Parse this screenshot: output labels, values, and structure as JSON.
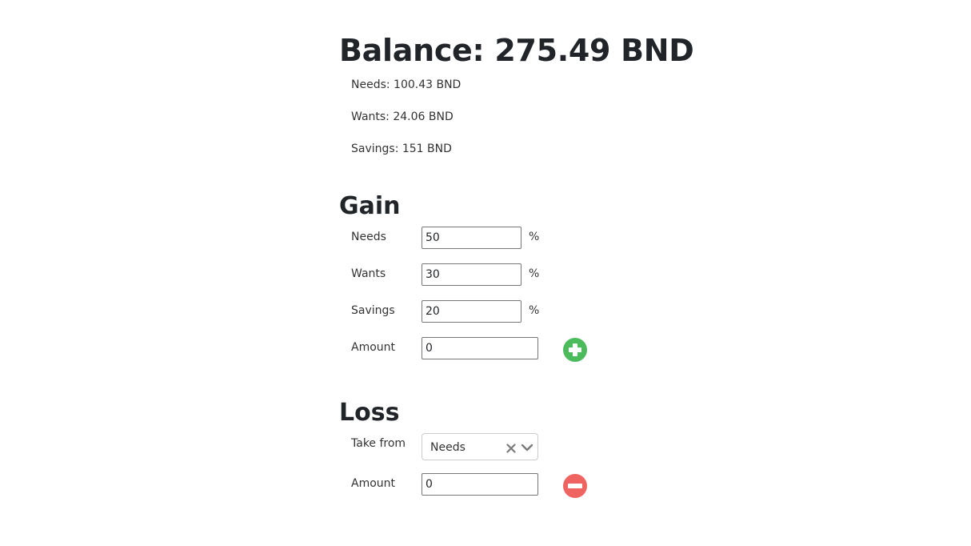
{
  "balance": {
    "title": "Balance: 275.49 BND",
    "needs": "Needs: 100.43 BND",
    "wants": "Wants: 24.06 BND",
    "savings": "Savings: 151 BND"
  },
  "gain": {
    "heading": "Gain",
    "needs_label": "Needs",
    "needs_value": "50",
    "wants_label": "Wants",
    "wants_value": "30",
    "savings_label": "Savings",
    "savings_value": "20",
    "percent_symbol": "%",
    "amount_label": "Amount",
    "amount_value": "0",
    "add_icon": "plus-circle-icon",
    "add_color": "#4cbb5c"
  },
  "loss": {
    "heading": "Loss",
    "take_from_label": "Take from",
    "take_from_value": "Needs",
    "clear_icon": "close-icon",
    "dropdown_icon": "chevron-down-icon",
    "amount_label": "Amount",
    "amount_value": "0",
    "remove_icon": "minus-circle-icon",
    "remove_color": "#ef6461"
  }
}
